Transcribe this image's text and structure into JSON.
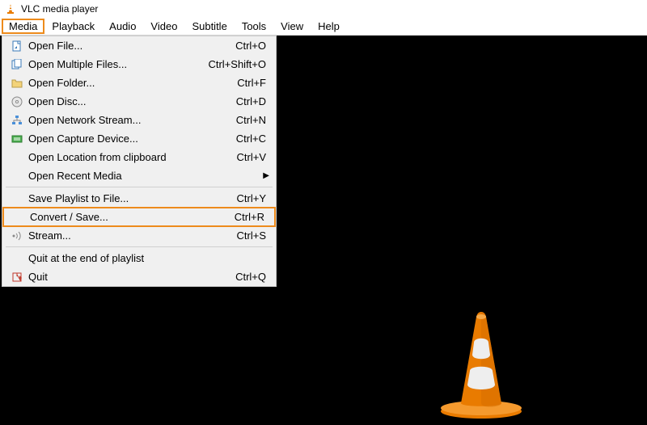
{
  "window": {
    "title": "VLC media player"
  },
  "menubar": [
    {
      "label": "Media",
      "highlight": true
    },
    {
      "label": "Playback"
    },
    {
      "label": "Audio"
    },
    {
      "label": "Video"
    },
    {
      "label": "Subtitle"
    },
    {
      "label": "Tools"
    },
    {
      "label": "View"
    },
    {
      "label": "Help"
    }
  ],
  "media_menu": [
    {
      "icon": "file-icon",
      "label": "Open File...",
      "shortcut": "Ctrl+O"
    },
    {
      "icon": "files-icon",
      "label": "Open Multiple Files...",
      "shortcut": "Ctrl+Shift+O"
    },
    {
      "icon": "folder-icon",
      "label": "Open Folder...",
      "shortcut": "Ctrl+F"
    },
    {
      "icon": "disc-icon",
      "label": "Open Disc...",
      "shortcut": "Ctrl+D"
    },
    {
      "icon": "network-icon",
      "label": "Open Network Stream...",
      "shortcut": "Ctrl+N"
    },
    {
      "icon": "capture-icon",
      "label": "Open Capture Device...",
      "shortcut": "Ctrl+C"
    },
    {
      "icon": "",
      "label": "Open Location from clipboard",
      "shortcut": "Ctrl+V"
    },
    {
      "icon": "",
      "label": "Open Recent Media",
      "shortcut": "",
      "submenu": true
    },
    {
      "separator": true
    },
    {
      "icon": "",
      "label": "Save Playlist to File...",
      "shortcut": "Ctrl+Y"
    },
    {
      "icon": "",
      "label": "Convert / Save...",
      "shortcut": "Ctrl+R",
      "highlight": true
    },
    {
      "icon": "stream-icon",
      "label": "Stream...",
      "shortcut": "Ctrl+S"
    },
    {
      "separator": true
    },
    {
      "icon": "",
      "label": "Quit at the end of playlist",
      "shortcut": ""
    },
    {
      "icon": "quit-icon",
      "label": "Quit",
      "shortcut": "Ctrl+Q"
    }
  ]
}
